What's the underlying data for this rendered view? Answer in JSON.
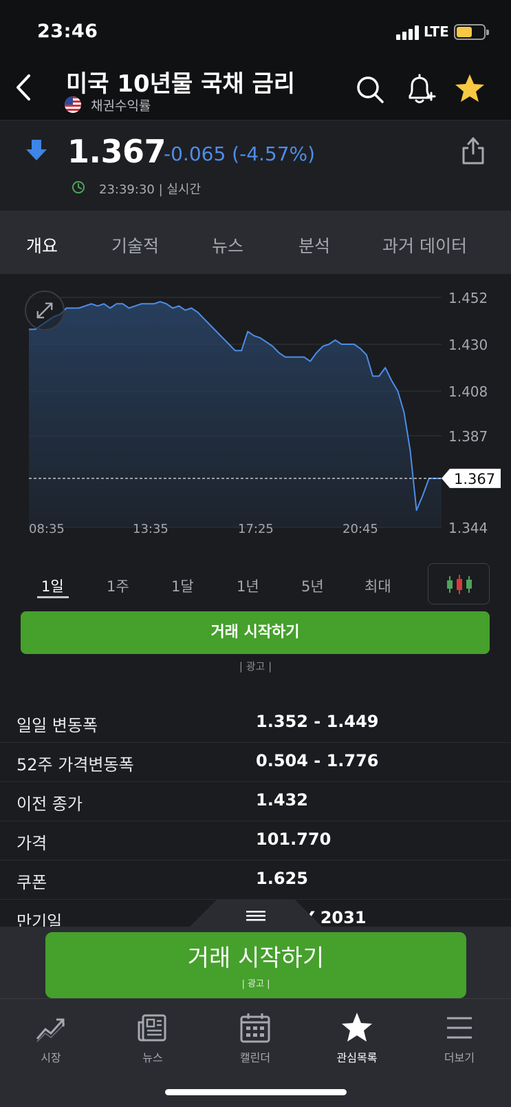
{
  "status_bar": {
    "time": "23:46",
    "network": "LTE"
  },
  "header": {
    "title": "미국 10년물 국채 금리",
    "subtitle": "채권수익률",
    "icons": [
      "back-icon",
      "us-flag-icon",
      "search-icon",
      "bell-plus-icon",
      "star-icon"
    ],
    "star_color": "#f7c844"
  },
  "quote": {
    "price": "1.367",
    "change": "-0.065 (-4.57%)",
    "timestamp": "23:39:30 | 실시간",
    "change_color": "#4d8de8"
  },
  "tabs": [
    {
      "label": "개요",
      "active": true
    },
    {
      "label": "기술적",
      "active": false
    },
    {
      "label": "뉴스",
      "active": false
    },
    {
      "label": "분석",
      "active": false
    },
    {
      "label": "과거 데이터",
      "active": false
    }
  ],
  "chart_data": {
    "type": "area",
    "y_ticks": [
      "1.452",
      "1.430",
      "1.408",
      "1.387",
      "1.344"
    ],
    "x_ticks": [
      "08:35",
      "13:35",
      "17:25",
      "20:45"
    ],
    "ylim": [
      1.344,
      1.452
    ],
    "current_label": "1.367",
    "current_value": 1.367,
    "line_color": "#4d8de8",
    "grid": true,
    "values": [
      1.437,
      1.437,
      1.439,
      1.441,
      1.443,
      1.444,
      1.447,
      1.447,
      1.447,
      1.448,
      1.449,
      1.448,
      1.449,
      1.447,
      1.449,
      1.449,
      1.447,
      1.448,
      1.449,
      1.449,
      1.449,
      1.45,
      1.449,
      1.447,
      1.448,
      1.446,
      1.447,
      1.445,
      1.442,
      1.439,
      1.436,
      1.433,
      1.43,
      1.427,
      1.427,
      1.436,
      1.434,
      1.433,
      1.431,
      1.429,
      1.426,
      1.424,
      1.424,
      1.424,
      1.424,
      1.422,
      1.426,
      1.429,
      1.43,
      1.432,
      1.43,
      1.43,
      1.43,
      1.428,
      1.425,
      1.415,
      1.415,
      1.419,
      1.413,
      1.408,
      1.398,
      1.38,
      1.352,
      1.359,
      1.367,
      1.367,
      1.367
    ]
  },
  "periods": [
    {
      "label": "1일",
      "active": true
    },
    {
      "label": "1주",
      "active": false
    },
    {
      "label": "1달",
      "active": false
    },
    {
      "label": "1년",
      "active": false
    },
    {
      "label": "5년",
      "active": false
    },
    {
      "label": "최대",
      "active": false
    }
  ],
  "trade_button": {
    "label": "거래 시작하기",
    "ad": "| 광고 |"
  },
  "stats": [
    {
      "label": "일일 변동폭",
      "value": "1.352 - 1.449"
    },
    {
      "label": "52주 가격변동폭",
      "value": "0.504 - 1.776"
    },
    {
      "label": "이전 종가",
      "value": "1.432"
    },
    {
      "label": "가격",
      "value": "101.770"
    },
    {
      "label": "쿠폰",
      "value": "1.625"
    },
    {
      "label": "만기일",
      "value": "Y 2031"
    }
  ],
  "cta": {
    "label": "거래 시작하기",
    "ad": "| 광고 |"
  },
  "bottom_nav": [
    {
      "label": "시장",
      "icon": "trend-chart-icon",
      "active": false
    },
    {
      "label": "뉴스",
      "icon": "newspaper-icon",
      "active": false
    },
    {
      "label": "캘린더",
      "icon": "calendar-icon",
      "active": false
    },
    {
      "label": "관심목록",
      "icon": "star-icon",
      "active": true
    },
    {
      "label": "더보기",
      "icon": "menu-icon",
      "active": false
    }
  ],
  "colors": {
    "accent_green": "#46a02c",
    "background": "#1b1c1f"
  }
}
